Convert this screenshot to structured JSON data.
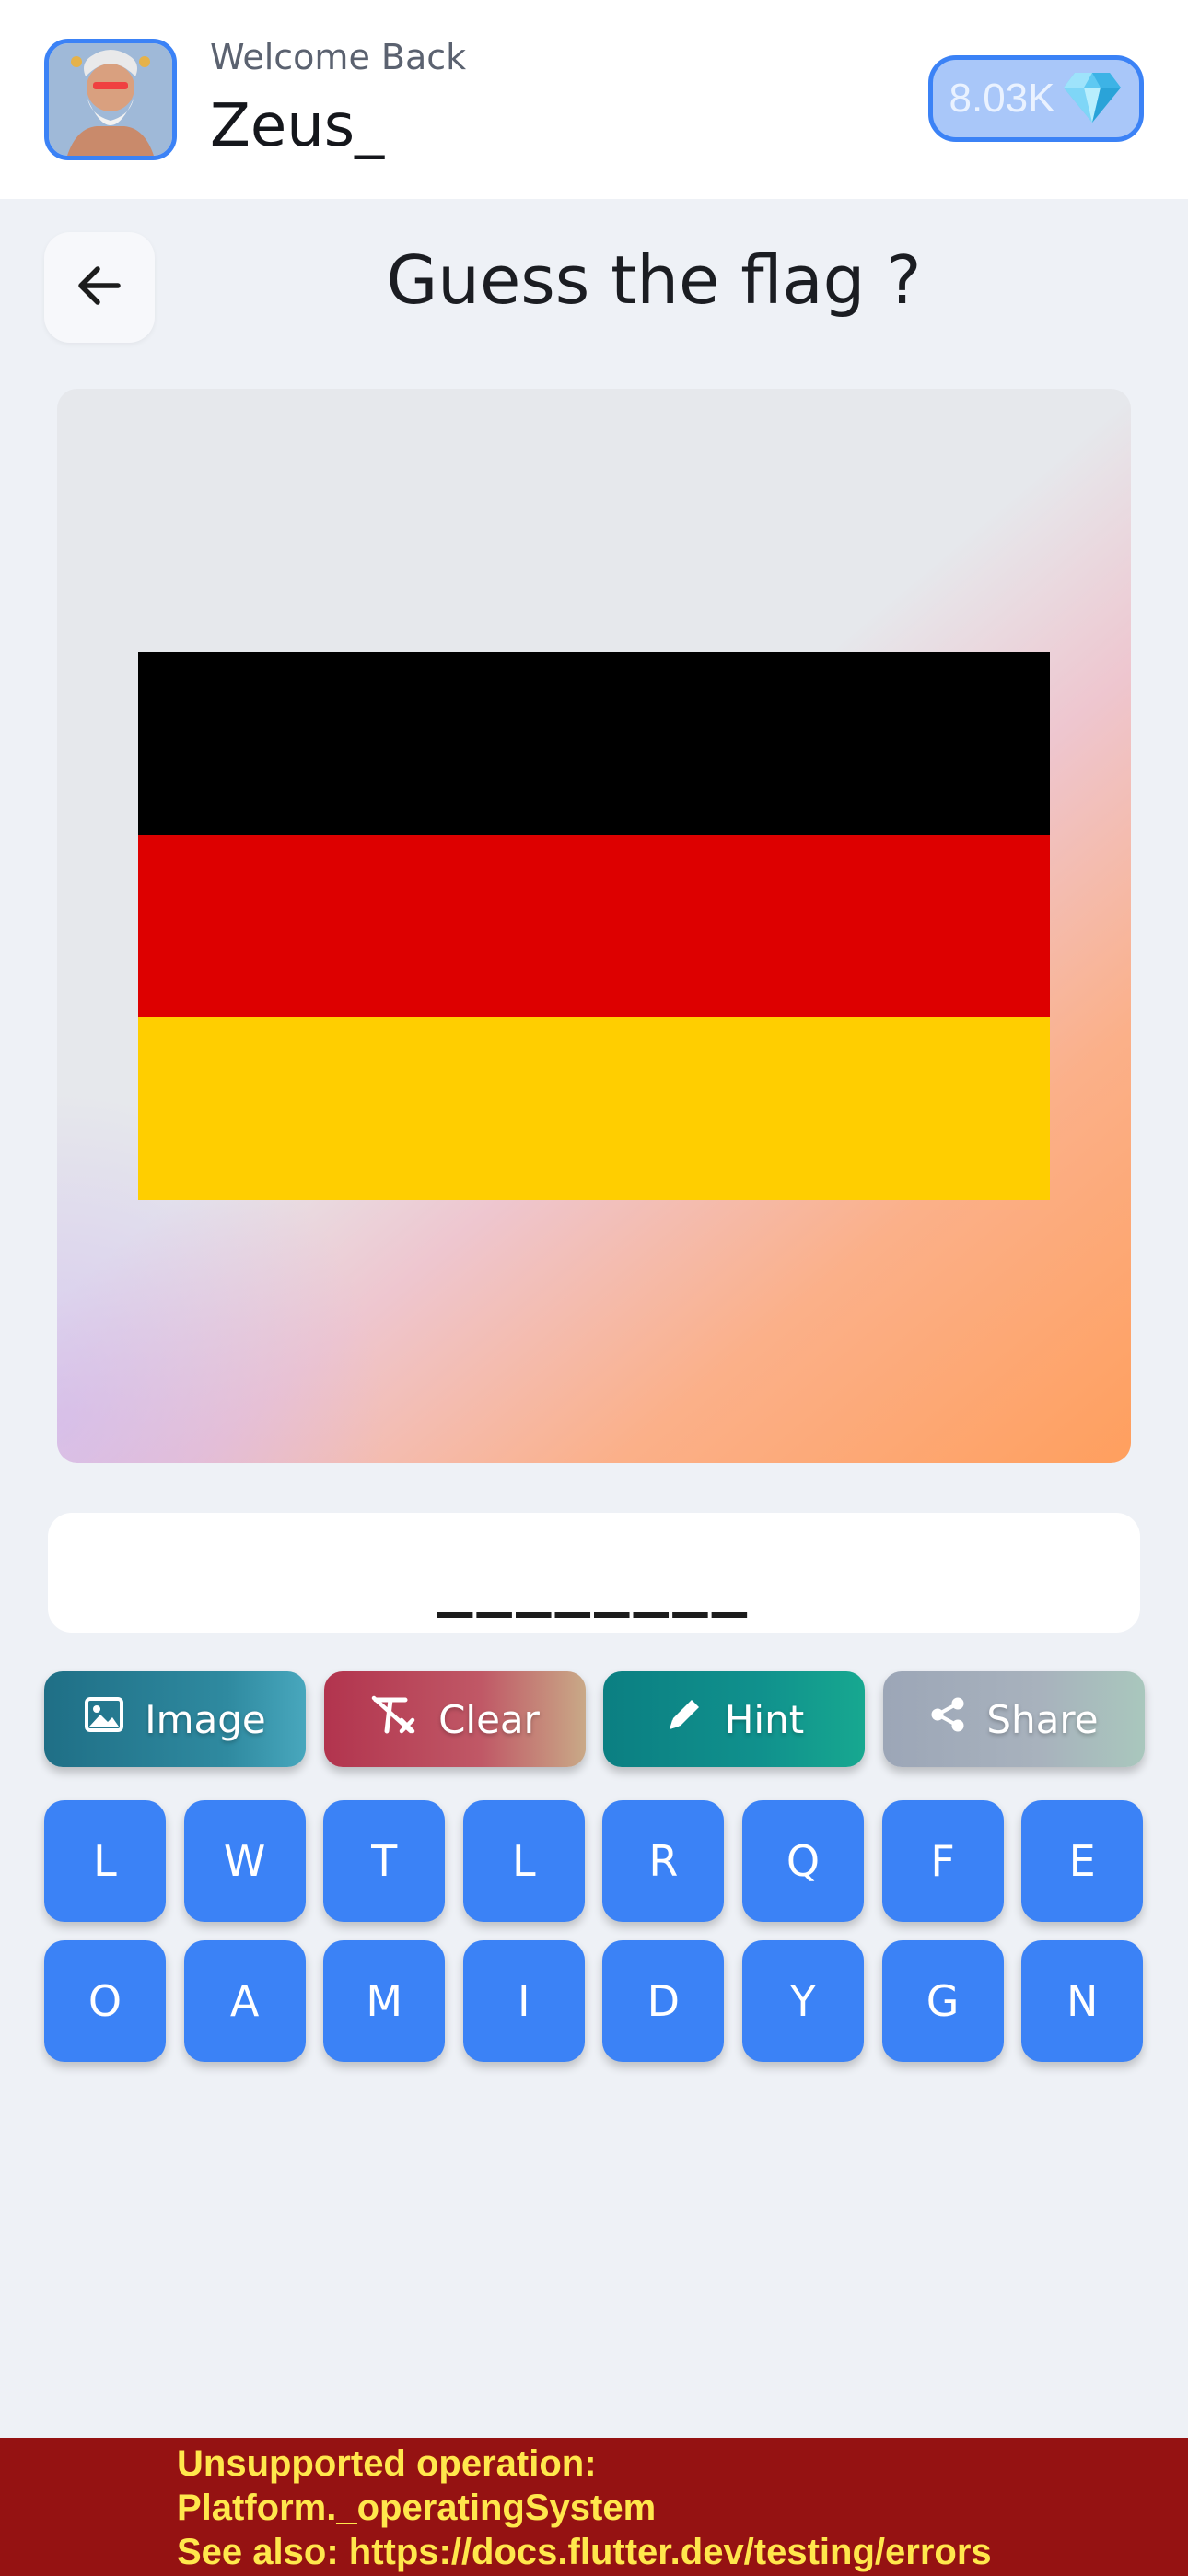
{
  "header": {
    "welcome_text": "Welcome Back",
    "username": "Zeus_",
    "gems": "8.03K",
    "gem_icon": "diamond-icon"
  },
  "quiz": {
    "title": "Guess the flag ?",
    "back_icon": "arrow-left-icon",
    "flag_colors": [
      "#000000",
      "#dd0000",
      "#ffce00"
    ],
    "answer_slots": "________"
  },
  "actions": [
    {
      "label": "Image",
      "icon": "image-icon"
    },
    {
      "label": "Clear",
      "icon": "clear-format-icon"
    },
    {
      "label": "Hint",
      "icon": "pencil-icon"
    },
    {
      "label": "Share",
      "icon": "share-icon"
    }
  ],
  "keys": [
    "L",
    "W",
    "T",
    "L",
    "R",
    "Q",
    "F",
    "E",
    "O",
    "A",
    "M",
    "I",
    "D",
    "Y",
    "G",
    "N"
  ],
  "error": {
    "line1": "Unsupported operation:",
    "line2": "Platform._operatingSystem",
    "line3": "See also: https://docs.flutter.dev/testing/errors"
  },
  "colors": {
    "accent": "#3b82f6",
    "background": "#eef1f6",
    "error_bg": "#951212",
    "error_text": "#ffe74c"
  }
}
